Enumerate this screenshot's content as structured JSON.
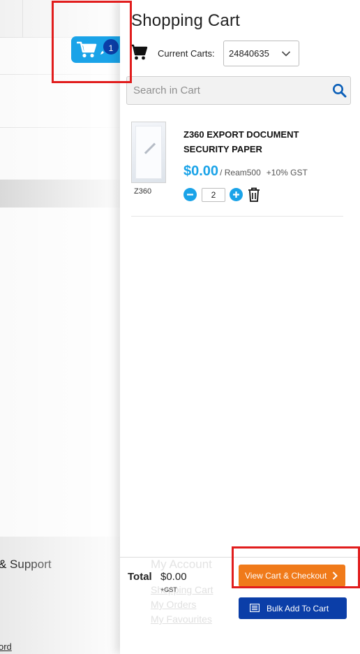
{
  "background": {
    "footer_heading": "& Support",
    "footer_link": "ord"
  },
  "header": {
    "cart_count": "1"
  },
  "drawer": {
    "title": "Shopping Cart",
    "current_carts_label": "Current Carts:",
    "current_cart_value": "24840635",
    "search_placeholder": "Search in Cart",
    "items": [
      {
        "name": "Z360 EXPORT DOCUMENT SECURITY PAPER",
        "sku": "Z360",
        "price": "$0.00",
        "unit": "/ Ream500",
        "gst_note": "+10% GST",
        "quantity": "2"
      }
    ],
    "footer": {
      "ghost_heading": "My Account",
      "ghost_links": [
        "Shopping Cart",
        "My Orders",
        "My Favourites"
      ],
      "total_label": "Total",
      "total_value": "$0.00",
      "total_gst": "+GST",
      "checkout_label": "View Cart & Checkout",
      "bulk_label": "Bulk Add To Cart"
    }
  },
  "colors": {
    "accent_blue": "#1aa3e8",
    "navy": "#0b3ea8",
    "checkout_orange": "#f07a1a",
    "highlight_red": "#e11d1d"
  }
}
